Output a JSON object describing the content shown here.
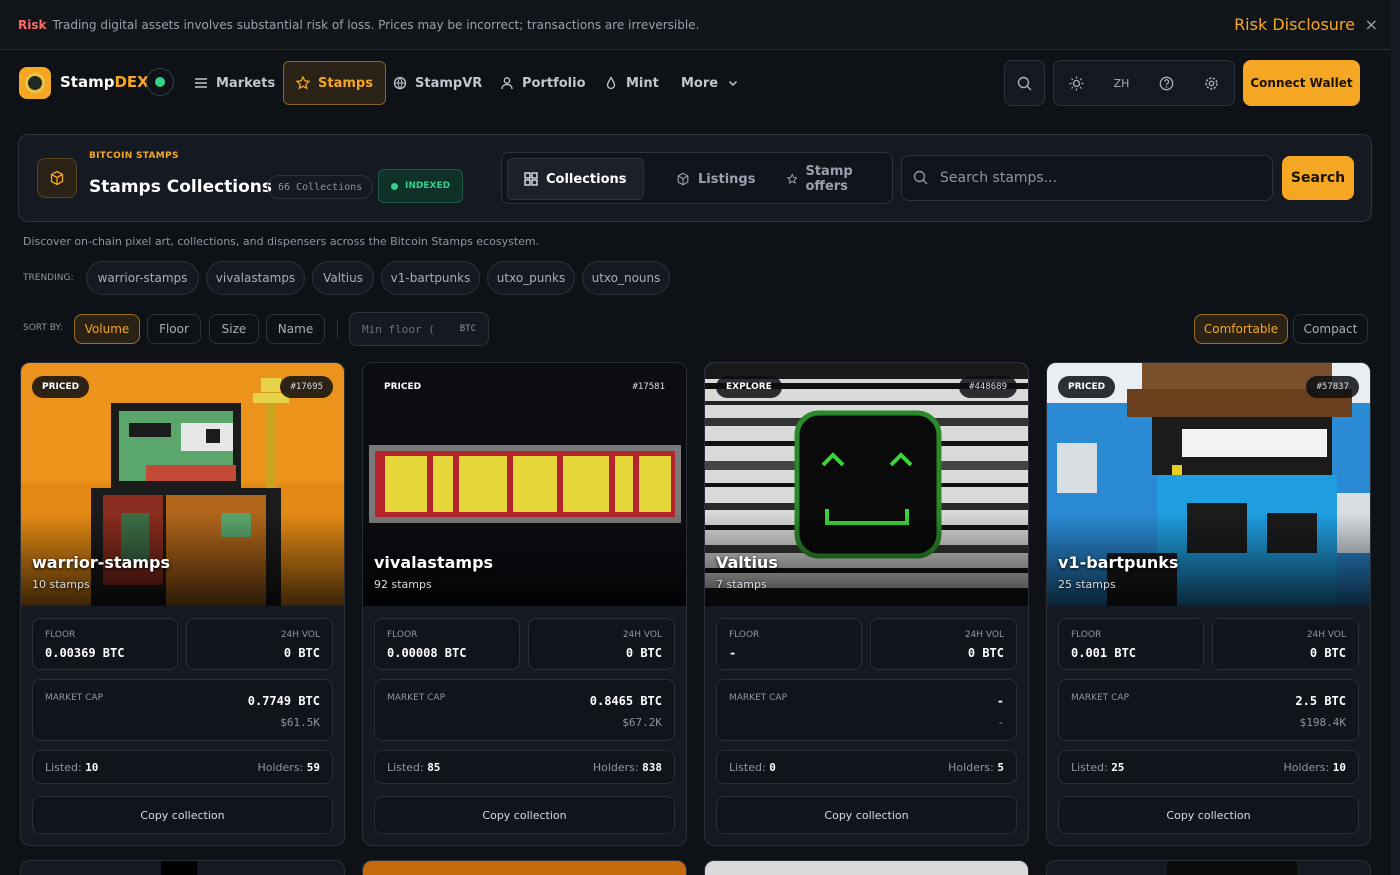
{
  "risk": {
    "tag": "Risk",
    "message": "Trading digital assets involves substantial risk of loss. Prices may be incorrect; transactions are irreversible.",
    "link": "Risk Disclosure",
    "close": "×"
  },
  "nav": {
    "brand_a": "Stamp",
    "brand_b": "DEX",
    "items": [
      "Markets",
      "Stamps",
      "StampVR",
      "Portfolio",
      "Mint",
      "More"
    ],
    "lang": "ZH",
    "connect": "Connect Wallet"
  },
  "header": {
    "kicker": "BITCOIN STAMPS",
    "title": "Stamps Collections",
    "count": "66 Collections",
    "status": "INDEXED",
    "tabs": [
      "Collections",
      "Listings",
      "Stamp offers"
    ],
    "search_placeholder": "Search stamps...",
    "search_button": "Search"
  },
  "description": "Discover on-chain pixel art, collections, and dispensers across the Bitcoin Stamps ecosystem.",
  "trending": {
    "label": "TRENDING:",
    "items": [
      "warrior-stamps",
      "vivalastamps",
      "Valtius",
      "v1-bartpunks",
      "utxo_punks",
      "utxo_nouns"
    ]
  },
  "sort": {
    "label": "SORT BY:",
    "options": [
      "Volume",
      "Floor",
      "Size",
      "Name"
    ],
    "min_floor_placeholder": "Min floor (",
    "min_floor_unit": "BTC"
  },
  "view": {
    "options": [
      "Comfortable",
      "Compact"
    ]
  },
  "labels": {
    "floor": "FLOOR",
    "vol": "24H VOL",
    "mcap": "MARKET CAP",
    "listed": "Listed:",
    "holders": "Holders:",
    "copy": "Copy collection"
  },
  "cards": [
    {
      "badge": "PRICED",
      "id": "#17695",
      "name": "warrior-stamps",
      "stamps": "10 stamps",
      "floor": "0.00369 BTC",
      "vol": "0 BTC",
      "mcap": "0.7749 BTC",
      "mcap_usd": "$61.5K",
      "listed": "10",
      "holders": "59"
    },
    {
      "badge": "PRICED",
      "id": "#17581",
      "name": "vivalastamps",
      "stamps": "92 stamps",
      "floor": "0.00008 BTC",
      "vol": "0 BTC",
      "mcap": "0.8465 BTC",
      "mcap_usd": "$67.2K",
      "listed": "85",
      "holders": "838"
    },
    {
      "badge": "EXPLORE",
      "id": "#448689",
      "name": "Valtius",
      "stamps": "7 stamps",
      "floor": "-",
      "vol": "0 BTC",
      "mcap": "-",
      "mcap_usd": "-",
      "listed": "0",
      "holders": "5"
    },
    {
      "badge": "PRICED",
      "id": "#57837",
      "name": "v1-bartpunks",
      "stamps": "25 stamps",
      "floor": "0.001 BTC",
      "vol": "0 BTC",
      "mcap": "2.5 BTC",
      "mcap_usd": "$198.4K",
      "listed": "25",
      "holders": "10"
    }
  ],
  "colors": {
    "accent": "#f5a623",
    "success": "#2fd48a",
    "background": "#0e1116"
  }
}
